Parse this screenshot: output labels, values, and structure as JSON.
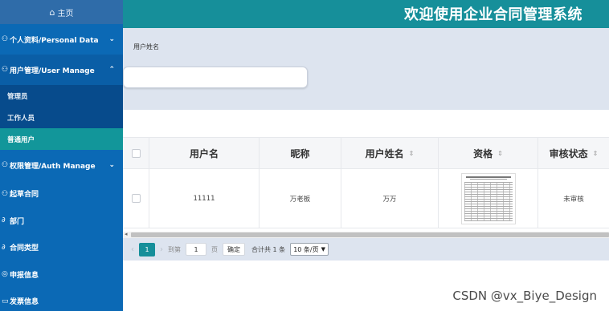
{
  "sidebar": {
    "home": {
      "icon": "home-icon",
      "label": "主页"
    },
    "groups": [
      {
        "icon": "person-icon",
        "label": "个人资料/Personal Data",
        "open": false
      },
      {
        "icon": "person-icon",
        "label": "用户管理/User Manage",
        "open": true
      }
    ],
    "user_manage_items": [
      {
        "label": "管理员",
        "active": false
      },
      {
        "label": "工作人员",
        "active": false
      },
      {
        "label": "普通用户",
        "active": true
      }
    ],
    "auth_group": {
      "icon": "person-icon",
      "label": "权限管理/Auth Manage"
    },
    "singles": [
      {
        "icon": "person-icon",
        "label": "起草合同"
      },
      {
        "icon": "link-icon",
        "label": "部门"
      },
      {
        "icon": "link-icon",
        "label": "合同类型"
      },
      {
        "icon": "target-icon",
        "label": "申报信息"
      },
      {
        "icon": "folder-icon",
        "label": "发票信息"
      }
    ]
  },
  "header": {
    "title": "欢迎使用企业合同管理系统"
  },
  "search": {
    "label": "用户姓名",
    "placeholder": ""
  },
  "table": {
    "columns": [
      {
        "label": "",
        "sortable": false
      },
      {
        "label": "用户名",
        "sortable": false
      },
      {
        "label": "昵称",
        "sortable": false
      },
      {
        "label": "用户姓名",
        "sortable": true
      },
      {
        "label": "资格",
        "sortable": true
      },
      {
        "label": "审核状态",
        "sortable": true
      }
    ],
    "rows": [
      {
        "username": "11111",
        "nickname": "万老板",
        "realname": "万万",
        "qualification": "document-thumbnail",
        "status": "未审核"
      }
    ]
  },
  "pagination": {
    "current_page": "1",
    "goto_label": "到第",
    "goto_value": "1",
    "page_unit": "页",
    "confirm_label": "确定",
    "total_label": "合计共 1 条",
    "page_size": "10 条/页"
  },
  "watermark": "CSDN @vx_Biye_Design",
  "colors": {
    "sidebar": "#0b69b5",
    "header": "#168f9a",
    "active": "#12969a",
    "accent": "#168f9a"
  }
}
